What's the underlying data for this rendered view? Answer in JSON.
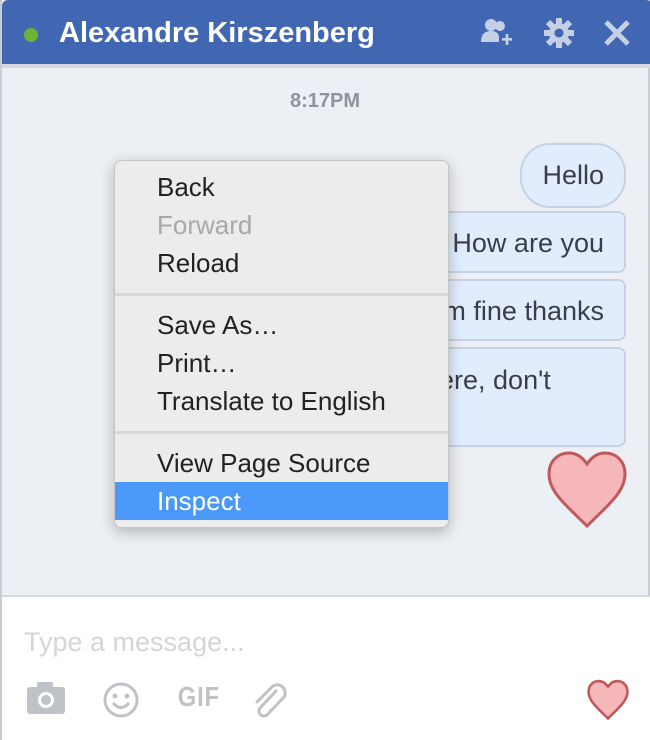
{
  "header": {
    "contact_name": "Alexandre Kirszenberg",
    "status": "online"
  },
  "conversation": {
    "timestamp": "8:17PM",
    "messages": [
      "Hello",
      "How are you",
      "I'm fine thanks",
      "here, don't"
    ]
  },
  "composer": {
    "placeholder": "Type a message...",
    "gif_label": "GIF"
  },
  "context_menu": {
    "groups": [
      [
        "Back",
        "Forward",
        "Reload"
      ],
      [
        "Save As…",
        "Print…",
        "Translate to English"
      ],
      [
        "View Page Source",
        "Inspect"
      ]
    ],
    "disabled": [
      "Forward"
    ],
    "highlighted": "Inspect"
  },
  "colors": {
    "header": "#4267b2",
    "online": "#6bb435",
    "highlight": "#4a98f7",
    "heart": "#f5b7b9"
  }
}
